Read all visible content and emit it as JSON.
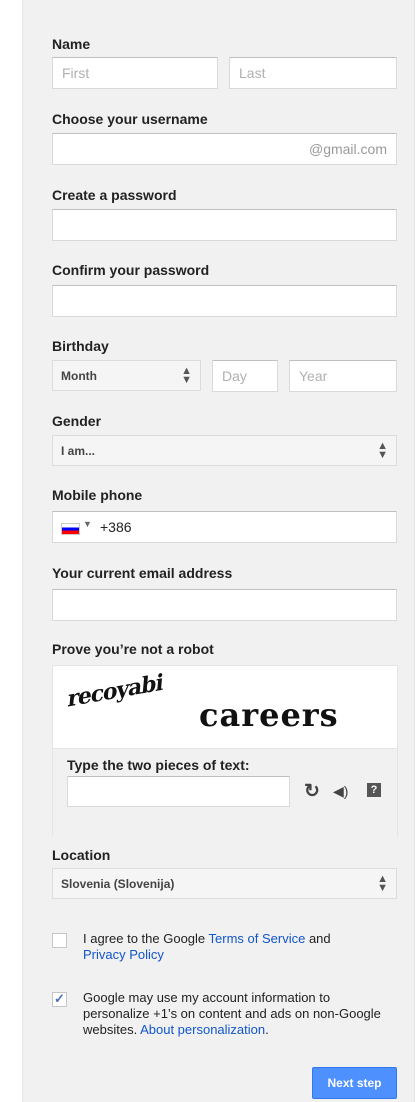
{
  "name": {
    "label": "Name",
    "first_placeholder": "First",
    "last_placeholder": "Last"
  },
  "username": {
    "label": "Choose your username",
    "suffix": "@gmail.com"
  },
  "password": {
    "label": "Create a password"
  },
  "confirm_password": {
    "label": "Confirm your password"
  },
  "birthday": {
    "label": "Birthday",
    "month_value": "Month",
    "day_placeholder": "Day",
    "year_placeholder": "Year"
  },
  "gender": {
    "label": "Gender",
    "value": "I am..."
  },
  "mobile": {
    "label": "Mobile phone",
    "value": "+386"
  },
  "email": {
    "label": "Your current email address"
  },
  "captcha": {
    "label": "Prove you’re not a robot",
    "word1": "recoyabi",
    "word2": "careers",
    "prompt": "Type the two pieces of text:"
  },
  "location": {
    "label": "Location",
    "value": "Slovenia (Slovenija)"
  },
  "terms": {
    "checked": false,
    "text_before": "I agree to the Google ",
    "tos_link": "Terms of Service",
    "text_and": " and",
    "privacy_link": "Privacy Policy"
  },
  "personalization": {
    "checked": true,
    "text": "Google may use my account information to personalize +1’s on content and ads on non-Google websites. ",
    "link": "About personalization",
    "end": "."
  },
  "next_button": "Next step",
  "colors": {
    "accent": "#4d90fe",
    "link": "#1155cc",
    "panel": "#f1f1f1"
  }
}
